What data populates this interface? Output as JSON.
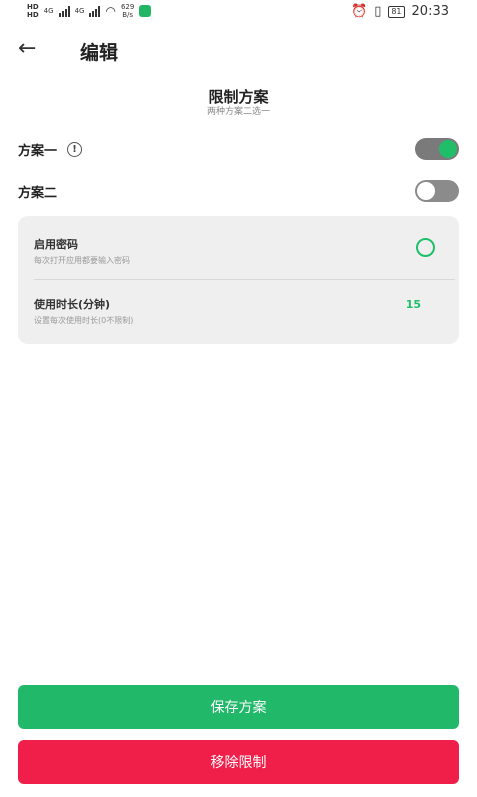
{
  "status_bar": {
    "hd1": "HD",
    "hd2": "HD",
    "net1": "4G",
    "net2": "4G",
    "speed_value": "629",
    "speed_unit": "B/s",
    "alarm_icon": "alarm-icon",
    "vibrate_icon": "vibrate-icon",
    "battery": "81",
    "time": "20:33"
  },
  "app_bar": {
    "back_icon": "arrow-left-icon",
    "title": "编辑"
  },
  "section": {
    "title": "限制方案",
    "subtitle": "两种方案二选一"
  },
  "plans": [
    {
      "label": "方案一",
      "enabled": true,
      "info_icon": "info-icon"
    },
    {
      "label": "方案二",
      "enabled": false
    }
  ],
  "options": [
    {
      "title": "启用密码",
      "subtitle": "每次打开应用都要输入密码",
      "control": "radio",
      "checked": false
    },
    {
      "title": "使用时长(分钟)",
      "subtitle": "设置每次使用时长(0不限制)",
      "value": "15"
    }
  ],
  "buttons": {
    "save": "保存方案",
    "remove": "移除限制"
  },
  "colors": {
    "accent_green": "#1fbf6a",
    "save_button": "#21b86a",
    "remove_button": "#ef1f4a",
    "card_bg": "#efefef"
  }
}
